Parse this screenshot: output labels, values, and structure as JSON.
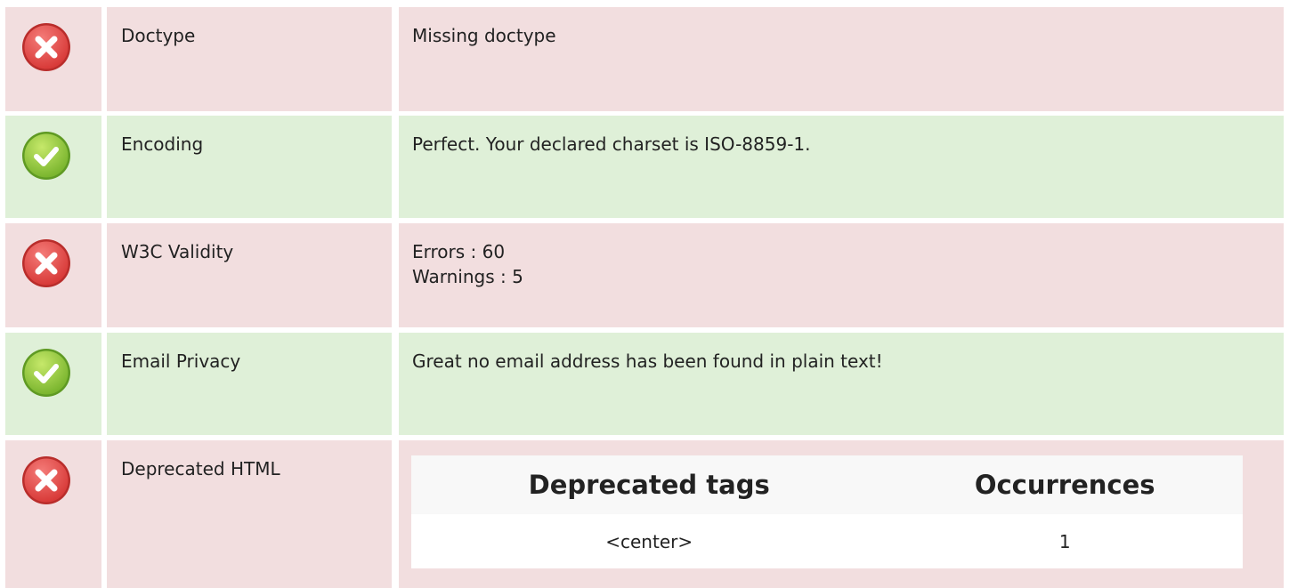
{
  "colors": {
    "fail_background": "#f2dedf",
    "pass_background": "#dff0d8",
    "fail_icon": "#e24a48",
    "pass_icon": "#8cc63f"
  },
  "rows": [
    {
      "status": "fail",
      "icon": "error-x-icon",
      "label": "Doctype",
      "lines": [
        "Missing doctype"
      ]
    },
    {
      "status": "pass",
      "icon": "success-check-icon",
      "label": "Encoding",
      "lines": [
        "Perfect. Your declared charset is ISO-8859-1."
      ]
    },
    {
      "status": "fail",
      "icon": "error-x-icon",
      "label": "W3C Validity",
      "lines": [
        "Errors : 60",
        "Warnings : 5"
      ]
    },
    {
      "status": "pass",
      "icon": "success-check-icon",
      "label": "Email Privacy",
      "lines": [
        "Great no email address has been found in plain text!"
      ]
    },
    {
      "status": "fail",
      "icon": "error-x-icon",
      "label": "Deprecated HTML",
      "table": {
        "headers": [
          "Deprecated tags",
          "Occurrences"
        ],
        "rows": [
          [
            "<center>",
            "1"
          ]
        ]
      }
    }
  ]
}
